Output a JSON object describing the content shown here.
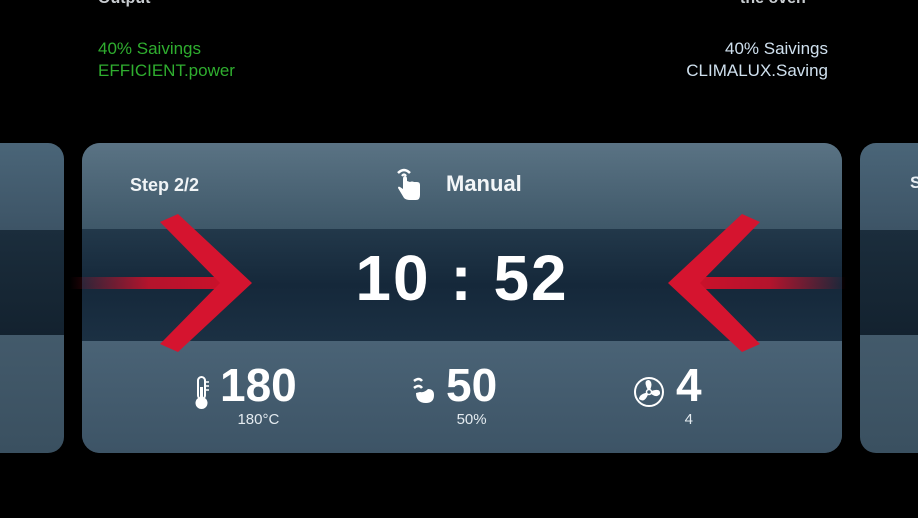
{
  "top_left": {
    "cutoff": "Output",
    "line1": "40% Saivings",
    "line2": "EFFICIENT.power"
  },
  "top_right": {
    "cutoff": "the oven",
    "line1": "40% Saivings",
    "line2": "CLIMALUX.Saving"
  },
  "card": {
    "step": "Step 2/2",
    "mode_label": "Manual",
    "time": "10 : 52",
    "temperature": {
      "value": "180",
      "sub": "180°C",
      "icon": "thermometer-icon"
    },
    "steam": {
      "value": "50",
      "sub": "50%",
      "icon": "steam-icon"
    },
    "fan": {
      "value": "4",
      "sub": "4",
      "icon": "fan-icon"
    }
  },
  "right_peek": {
    "label": "S"
  },
  "colors": {
    "arrow": "#d0102a",
    "green_text": "#2fae2f",
    "card_top": "#5a7384",
    "card_mid": "#15283a"
  }
}
